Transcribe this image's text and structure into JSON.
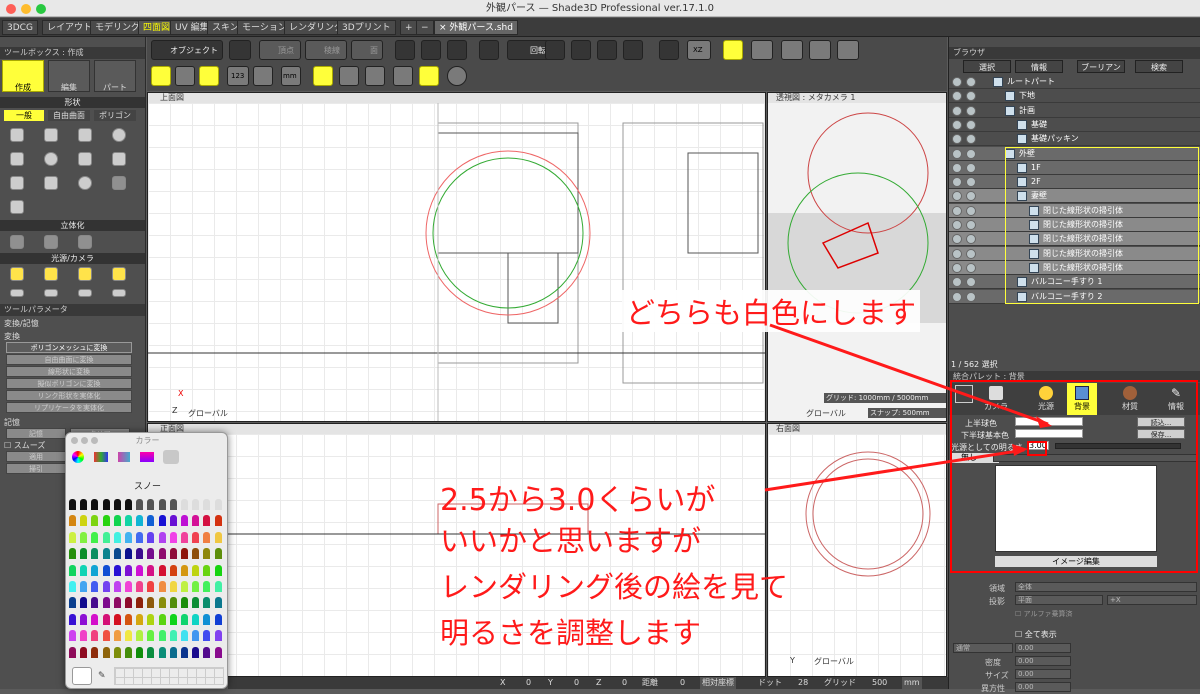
{
  "window": {
    "title": "外観パース — Shade3D Professional ver.17.1.0"
  },
  "tabs": [
    "3DCG",
    "レイアウト",
    "モデリング",
    "四面図",
    "UV 編集",
    "スキン",
    "モーション",
    "レンダリング",
    "3Dプリント",
    "+",
    "−",
    "× 外観パース.shd"
  ],
  "left_panel": {
    "toolbox_title": "ツールボックス : 作成",
    "modes": [
      "作成",
      "編集",
      "パート"
    ],
    "shape_header": "形状",
    "shape_tabs": [
      "一般",
      "自由曲面",
      "ポリゴン"
    ],
    "solid_header": "立体化",
    "light_header": "光源/カメラ",
    "param_title": "ツールパラメータ",
    "section": "変換/記憶",
    "convert_label": "変換",
    "convert_buttons": [
      "ポリゴンメッシュに変換",
      "自由曲面に変換",
      "線形状に変換",
      "擬似ポリゴンに変換",
      "リンク形状を実体化",
      "リプリケータを実体化"
    ],
    "memory_label": "記憶",
    "memory_buttons": [
      "記憶",
      "クリア"
    ],
    "smooth_label": "スムーズ",
    "apply_buttons": [
      "適用",
      "掃引"
    ]
  },
  "toolbar": {
    "object_label": "オブジェクト",
    "vertex_label": "頂点",
    "edge_label": "稜線",
    "face_label": "面",
    "rotate_label": "回転",
    "label_123": "123",
    "label_mm": "mm",
    "label_xz": "XZ"
  },
  "viewports": {
    "top": {
      "label": "上面図"
    },
    "perspective": {
      "label": "透視図 : メタカメラ 1",
      "grid_text": "グリッド: 1000mm / 5000mm",
      "snap_text": "スナップ: 500mm",
      "global": "グローバル"
    },
    "front": {
      "label": "正面図"
    },
    "right": {
      "label": "右面図"
    },
    "global_label": "グローバル",
    "axis_x": "X",
    "axis_z": "Z",
    "axis_y": "Y"
  },
  "browser": {
    "title": "ブラウザ",
    "tabs": [
      "選択",
      "情報",
      "ブーリアン",
      "検索"
    ],
    "items": [
      {
        "label": "ルートパート",
        "indent": 0
      },
      {
        "label": "下地",
        "indent": 1
      },
      {
        "label": "計画",
        "indent": 1
      },
      {
        "label": "基礎",
        "indent": 2
      },
      {
        "label": "基礎パッキン",
        "indent": 2
      },
      {
        "label": "外壁",
        "indent": 1
      },
      {
        "label": "1F",
        "indent": 2
      },
      {
        "label": "2F",
        "indent": 2
      },
      {
        "label": "妻壁",
        "indent": 2
      },
      {
        "label": "閉じた線形状の掃引体",
        "indent": 3
      },
      {
        "label": "閉じた線形状の掃引体",
        "indent": 3
      },
      {
        "label": "閉じた線形状の掃引体",
        "indent": 3
      },
      {
        "label": "閉じた線形状の掃引体",
        "indent": 3
      },
      {
        "label": "閉じた線形状の掃引体",
        "indent": 3
      },
      {
        "label": "バルコニー手すり 1",
        "indent": 2
      },
      {
        "label": "バルコニー手すり 2",
        "indent": 2
      }
    ],
    "status": "1 / 562 選択"
  },
  "palette": {
    "title": "統合パレット : 背景",
    "tabs": [
      "カメラ",
      "光源",
      "背景",
      "材質",
      "情報"
    ],
    "upper_label": "上半球色",
    "lower_label": "下半球基本色",
    "light_label": "光源としての明るさ",
    "light_value": "3.00",
    "read_button": "読込...",
    "save_button": "保存...",
    "none_label": "無し",
    "image_edit": "イメージ編集",
    "params": [
      {
        "label": "領域",
        "value": "全体"
      },
      {
        "label": "投影",
        "value": "平面"
      },
      {
        "label": "",
        "value": "+X"
      }
    ],
    "alpha_label": "アルファ乗算済",
    "full_label": "全て表示",
    "mode_value": "通常",
    "density_label": "密度",
    "size_label": "サイズ",
    "aspect_label": "異方性",
    "zero": "0.00"
  },
  "color_window": {
    "title": "カラー",
    "selected_name": "スノー"
  },
  "status_bar": {
    "x_label": "X",
    "x_value": "0",
    "y_label": "Y",
    "y_value": "0",
    "z_label": "Z",
    "z_value": "0",
    "dist_label": "距離",
    "dist_value": "0",
    "coord_mode": "相対座標",
    "dot_label": "ドット",
    "dot_value": "28",
    "grid_label": "グリッド",
    "grid_value": "500",
    "unit": "mm"
  },
  "annotations": {
    "white_note": "どちらも白色にします",
    "value_note": [
      "2.5から3.0くらいが",
      "いいかと思いますが",
      "レンダリング後の絵を見て",
      "明るさを調整します"
    ],
    "accent_color": "#ff1a1a",
    "highlight_color": "#ffff3a"
  }
}
